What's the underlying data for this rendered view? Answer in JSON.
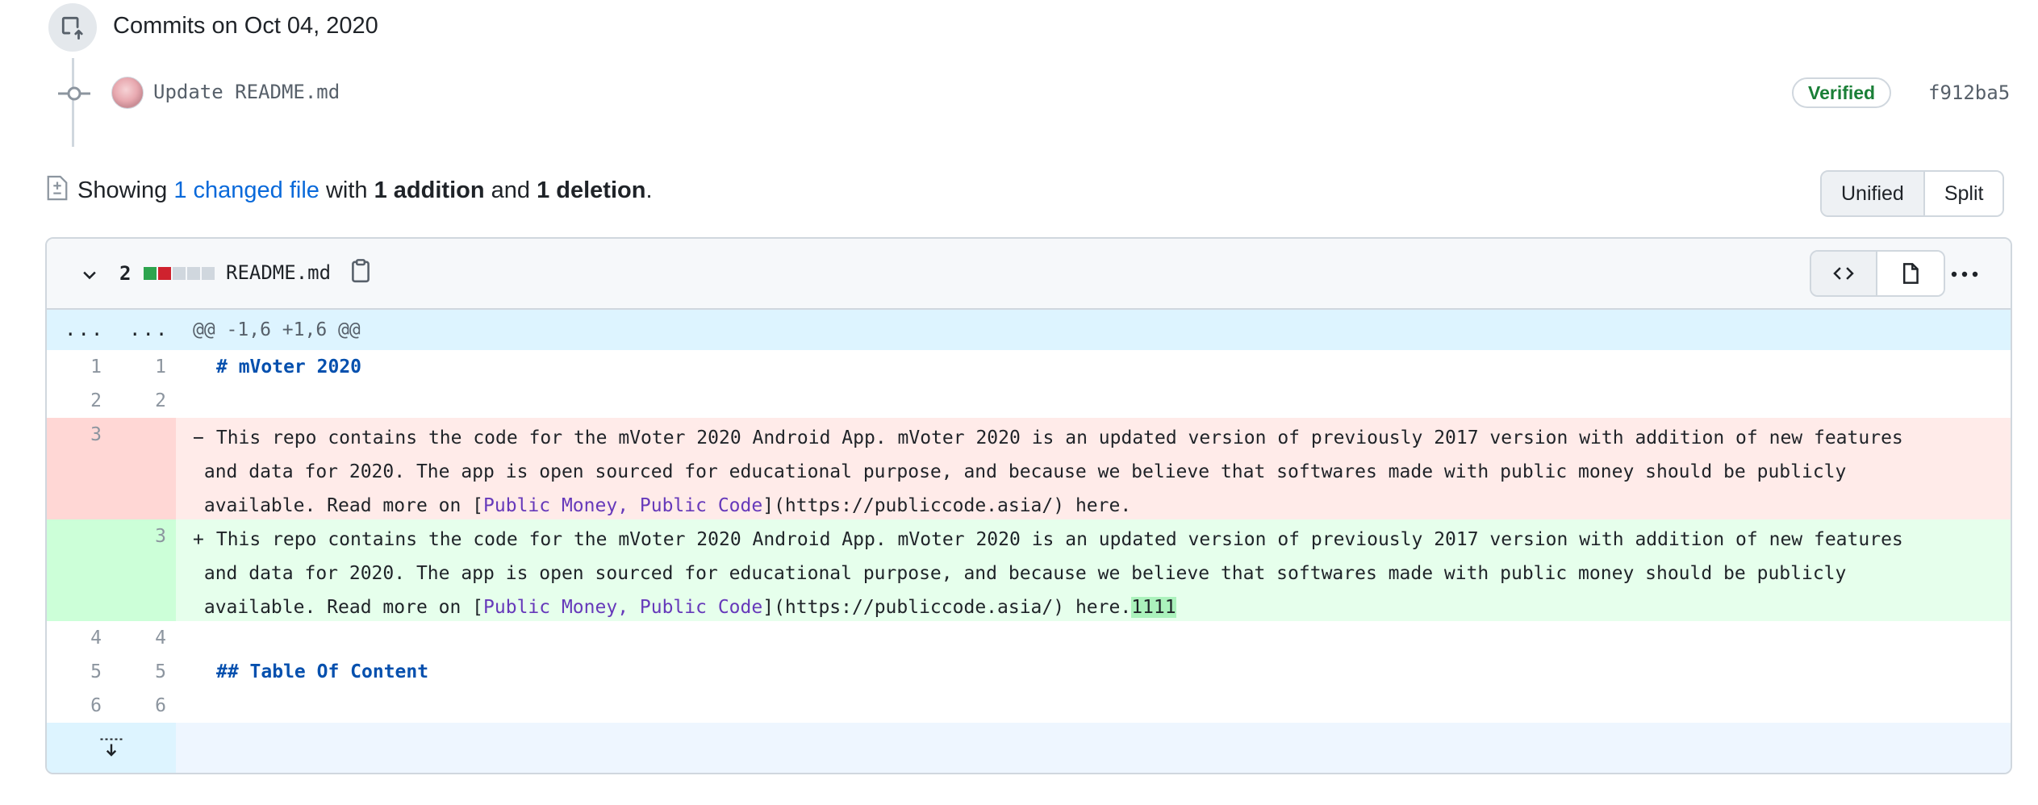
{
  "commit_group": {
    "heading": "Commits on Oct 04, 2020",
    "commit": {
      "message": "Update README.md",
      "badge": "Verified",
      "sha": "f912ba5"
    }
  },
  "summary": {
    "prefix": "Showing",
    "changed_link": "1 changed file",
    "with": "with",
    "additions": "1 addition",
    "and": "and",
    "deletions": "1 deletion",
    "period": "."
  },
  "view_toggle": {
    "unified": "Unified",
    "split": "Split",
    "selected": "Unified"
  },
  "file": {
    "change_count": "2",
    "name": "README.md",
    "diffstat": [
      "added",
      "deleted",
      "neutral",
      "neutral",
      "neutral"
    ],
    "colors": {
      "added": "#2da44e",
      "deleted": "#cf222e",
      "neutral": "#d0d7de"
    }
  },
  "diff": {
    "hunk_old_dots": "...",
    "hunk_new_dots": "...",
    "hunk_header": "@@ -1,6 +1,6 @@",
    "line1": {
      "old": "1",
      "new": "1",
      "text": "# mVoter 2020"
    },
    "line2": {
      "old": "2",
      "new": "2",
      "text": ""
    },
    "deleted": {
      "old": "3",
      "marker": "−",
      "l1": " This repo contains the code for the mVoter 2020 Android App. mVoter 2020 is an updated version of previously 2017 version with addition of new features",
      "l2": " and data for 2020. The app is open sourced for educational purpose, and because we believe that softwares made with public money should be publicly",
      "l3_pre": " available. Read more on [",
      "l3_link": "Public Money, Public Code",
      "l3_post": "](https://publiccode.asia/) here."
    },
    "added": {
      "new": "3",
      "marker": "+",
      "l1": " This repo contains the code for the mVoter 2020 Android App. mVoter 2020 is an updated version of previously 2017 version with addition of new features",
      "l2": " and data for 2020. The app is open sourced for educational purpose, and because we believe that softwares made with public money should be publicly",
      "l3_pre": " available. Read more on [",
      "l3_link": "Public Money, Public Code",
      "l3_post": "](https://publiccode.asia/) here.",
      "l3_highlight": "1111"
    },
    "line4": {
      "old": "4",
      "new": "4",
      "text": ""
    },
    "line5": {
      "old": "5",
      "new": "5",
      "text": "## Table Of Content"
    },
    "line6": {
      "old": "6",
      "new": "6",
      "text": ""
    }
  }
}
